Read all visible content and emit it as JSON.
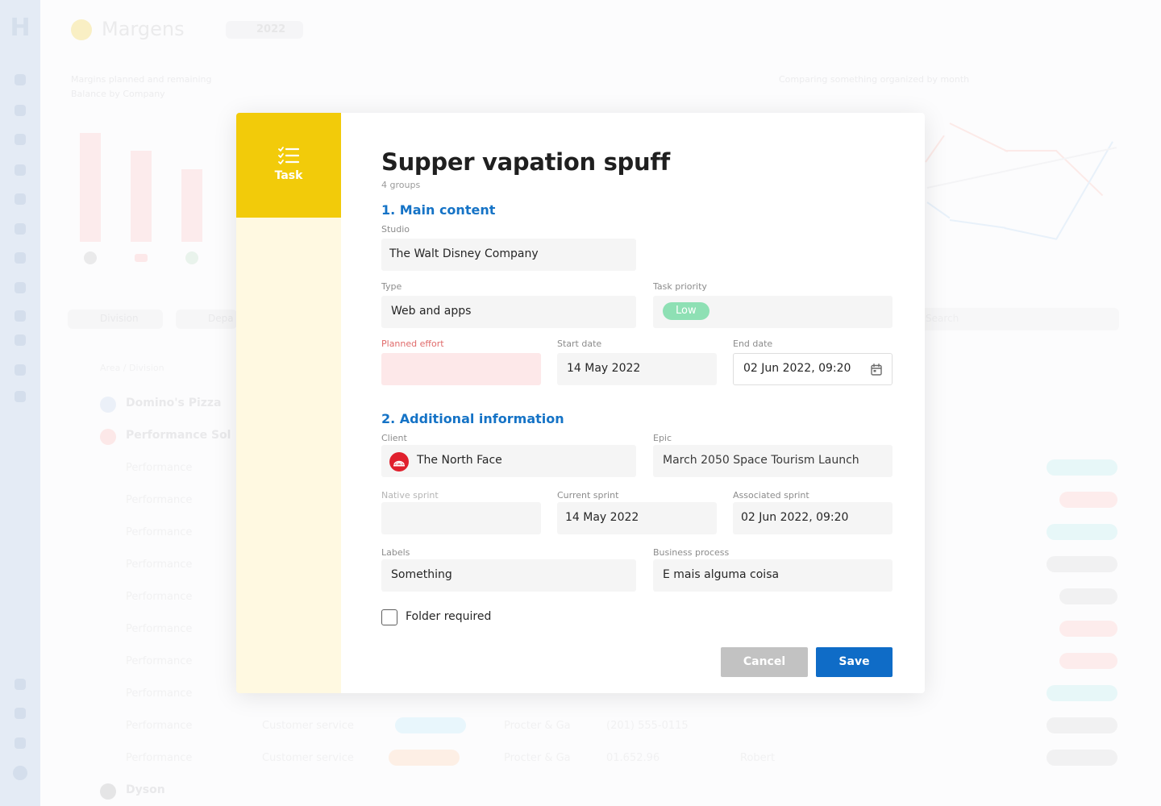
{
  "background": {
    "app_title": "Margens",
    "year_selector": "2022",
    "chart_left_title": "Margins planned and remaining",
    "chart_left_subtitle": "Balance by Company",
    "chart_right_title": "Comparing something organized by month",
    "filters": [
      "Division",
      "Depa"
    ],
    "search_placeholder": "Search",
    "table_header": [
      "Area / Division"
    ],
    "group_rows": [
      "Domino's Pizza",
      "Performance Sol",
      "Dyson"
    ],
    "rows": [
      "Performance",
      "Performance",
      "Performance",
      "Performance",
      "Performance",
      "Performance",
      "Performance",
      "Performance",
      "Performance",
      "Performance"
    ],
    "row_cells": [
      "Customer service",
      "Procter & Ga",
      "(201) 555-0115",
      "Customer service",
      "Procter & Ga",
      "01.652.96",
      "Robert"
    ]
  },
  "modal": {
    "side_tab": {
      "label": "Task",
      "icon": "task-checklist-icon"
    },
    "title": "Supper vapation spuff",
    "subtitle": "4 groups",
    "section1": {
      "title": "1. Main content",
      "studio": {
        "label": "Studio",
        "value": "The Walt Disney Company"
      },
      "type": {
        "label": "Type",
        "value": "Web and apps"
      },
      "task_priority": {
        "label": "Task priority",
        "value": "Low",
        "color": "#8ee0b4"
      },
      "planned_effort": {
        "label": "Planned effort",
        "value": ""
      },
      "start_date": {
        "label": "Start date",
        "value": "14 May 2022"
      },
      "end_date": {
        "label": "End date",
        "value": "02 Jun 2022, 09:20"
      }
    },
    "section2": {
      "title": "2. Additional information",
      "client": {
        "label": "Client",
        "value": "The North Face"
      },
      "epic": {
        "label": "Epic",
        "value": "March 2050 Space Tourism Launch"
      },
      "native_sprint": {
        "label": "Native sprint",
        "value": ""
      },
      "current_sprint": {
        "label": "Current sprint",
        "value": "14 May 2022"
      },
      "associated_sprint": {
        "label": "Associated sprint",
        "value": "02 Jun 2022, 09:20"
      },
      "labels": {
        "label": "Labels",
        "value": "Something"
      },
      "business_process": {
        "label": "Business process",
        "value": "E mais alguma coisa"
      }
    },
    "folder_required": {
      "label": "Folder required",
      "checked": false
    },
    "cancel_label": "Cancel",
    "save_label": "Save"
  },
  "colors": {
    "accent_yellow": "#f2cb0a",
    "side_panel": "#fff9e1",
    "section_blue": "#1573c6",
    "save_blue": "#0f6cc7",
    "cancel_grey": "#c2c2c2",
    "error_red": "#e06b6b"
  }
}
